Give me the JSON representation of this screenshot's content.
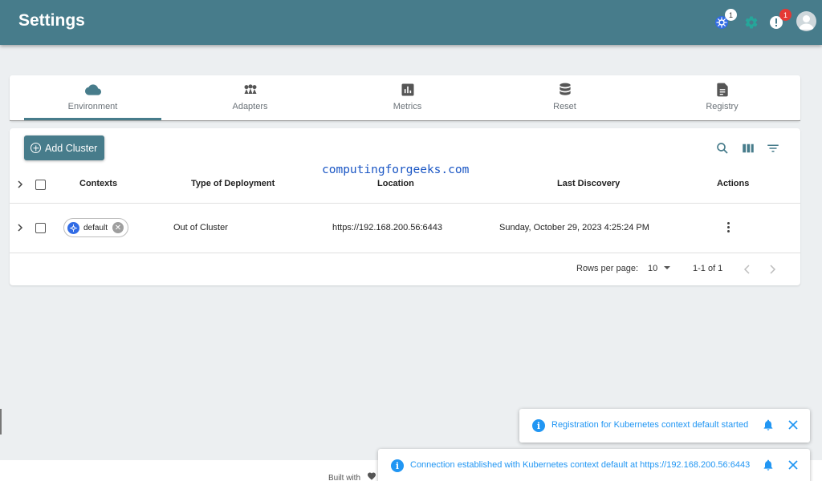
{
  "header": {
    "title": "Settings",
    "kubernetes_badge": "1",
    "notification_badge": "1"
  },
  "tabs": [
    {
      "label": "Environment",
      "icon": "cloud-icon",
      "active": true
    },
    {
      "label": "Adapters",
      "icon": "adapters-icon",
      "active": false
    },
    {
      "label": "Metrics",
      "icon": "bar-chart-icon",
      "active": false
    },
    {
      "label": "Reset",
      "icon": "database-icon",
      "active": false
    },
    {
      "label": "Registry",
      "icon": "document-icon",
      "active": false
    }
  ],
  "toolbar": {
    "add_cluster_label": "Add Cluster"
  },
  "watermark": "computingforgeeks.com",
  "table": {
    "columns": [
      "Contexts",
      "Type of Deployment",
      "Location",
      "Last Discovery",
      "Actions"
    ],
    "rows": [
      {
        "context": "default",
        "type": "Out of Cluster",
        "location": "https://192.168.200.56:6443",
        "last_discovery": "Sunday, October 29, 2023 4:25:24 PM"
      }
    ]
  },
  "pagination": {
    "rows_per_page_label": "Rows per page:",
    "rows_per_page": "10",
    "range": "1-1 of 1"
  },
  "footer": {
    "built_with": "Built with"
  },
  "toasts": [
    {
      "message": "Registration for Kubernetes context default started"
    },
    {
      "message": "Connection established with Kubernetes context default at https://192.168.200.56:6443"
    }
  ],
  "colors": {
    "header": "#477c8b",
    "info": "#2196f3",
    "badge_red": "#e53935",
    "kubernetes": "#326ce5",
    "settings_gear": "#26a69a"
  }
}
